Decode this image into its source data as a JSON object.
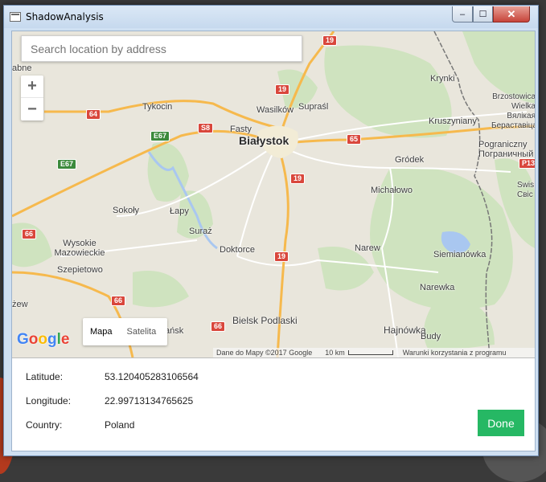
{
  "window": {
    "title": "ShadowAnalysis",
    "controls": {
      "minimize": "‒",
      "maximize": "☐",
      "close": "✕"
    }
  },
  "map": {
    "search_placeholder": "Search location by address",
    "zoom_in": "+",
    "zoom_out": "−",
    "map_types": [
      "Mapa",
      "Satelita"
    ],
    "google_logo": "Google",
    "attribution": "Dane do Mapy ©2017 Google",
    "scale_label": "10 km",
    "terms": "Warunki korzystania z programu",
    "cities": {
      "bialystok": "Białystok",
      "tykocin": "Tykocin",
      "wasilkow": "Wasilków",
      "suprasl": "Supraśl",
      "fasty": "Fasty",
      "krynki": "Krynki",
      "brzostowica": "Brzostowica Wielka",
      "brzostowica_cyr": "Вялікая Бераставіца",
      "kruszyniany": "Kruszyniany",
      "pograniczny": "Pograniczny",
      "pograniczny_cyr": "Пограничный",
      "grodek": "Gródek",
      "swis": "Swis",
      "swis_cyr": "Свіс",
      "michalowo": "Michałowo",
      "sokoly": "Sokoły",
      "lapy": "Łapy",
      "suraz": "Suraż",
      "wysokie": "Wysokie Mazowieckie",
      "doktorce": "Doktorce",
      "narew": "Narew",
      "siemianowka": "Siemianówka",
      "szepietowo": "Szepietowo",
      "narewka": "Narewka",
      "bielsk": "Bielsk Podlaski",
      "hajnowka": "Hajnówka",
      "budy": "Budy",
      "left_top": "abne",
      "left_mid": "żew",
      "left_bottom": "ańsk"
    },
    "roads": {
      "r19a": "19",
      "r19b": "19",
      "r19c": "19",
      "r19d": "19",
      "r64": "64",
      "r65": "65",
      "r66a": "66",
      "r66b": "66",
      "r66c": "66",
      "e67a": "E67",
      "e67b": "E67",
      "s8": "S8",
      "p13": "P13"
    }
  },
  "info": {
    "latitude_label": "Latitude:",
    "latitude_value": "53.120405283106564",
    "longitude_label": "Longitude:",
    "longitude_value": "22.99713134765625",
    "country_label": "Country:",
    "country_value": "Poland",
    "done_label": "Done"
  },
  "colors": {
    "done_button": "#26b864",
    "map_land": "#e9e6dc",
    "map_green": "#cfe3bf",
    "road_major": "#f6b94d",
    "road_badge_red": "#d9473c",
    "road_badge_green": "#3c8a3c"
  }
}
